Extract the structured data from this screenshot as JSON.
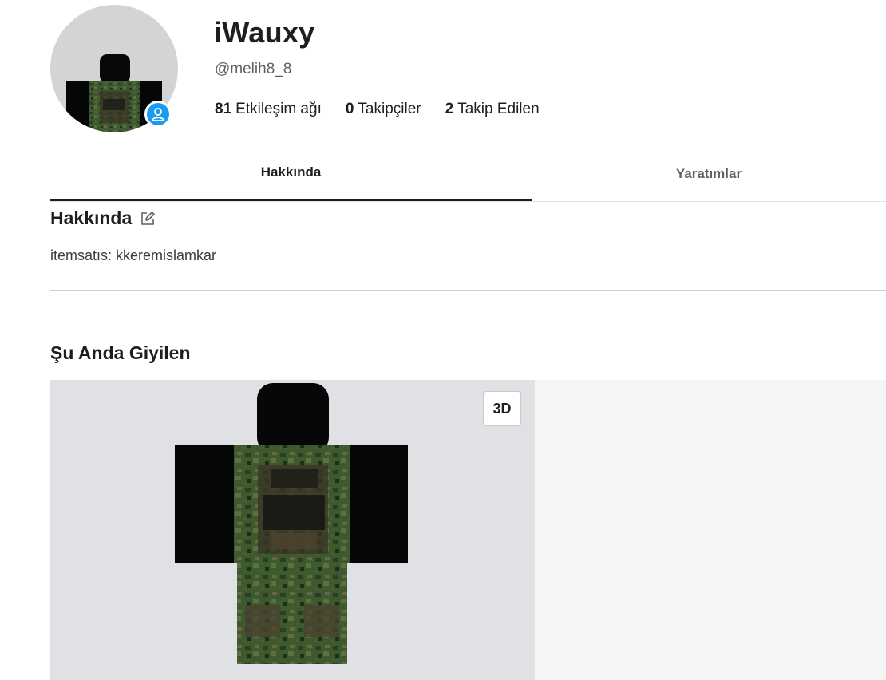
{
  "profile": {
    "display_name": "iWauxy",
    "username": "@melih8_8",
    "stats": [
      {
        "count": "81",
        "label": "Etkileşim ağı"
      },
      {
        "count": "0",
        "label": "Takipçiler"
      },
      {
        "count": "2",
        "label": "Takip Edilen"
      }
    ]
  },
  "tabs": [
    {
      "label": "Hakkında",
      "active": true
    },
    {
      "label": "Yaratımlar",
      "active": false
    }
  ],
  "about": {
    "title": "Hakkında",
    "text": "itemsatıs: kkeremislamkar"
  },
  "wearing": {
    "title": "Şu Anda Giyilen",
    "view_toggle_label": "3D"
  },
  "colors": {
    "badge": "#1b9bf0",
    "viewer_bg": "#dfe1e4",
    "camo_base": "#3f5a2f"
  }
}
